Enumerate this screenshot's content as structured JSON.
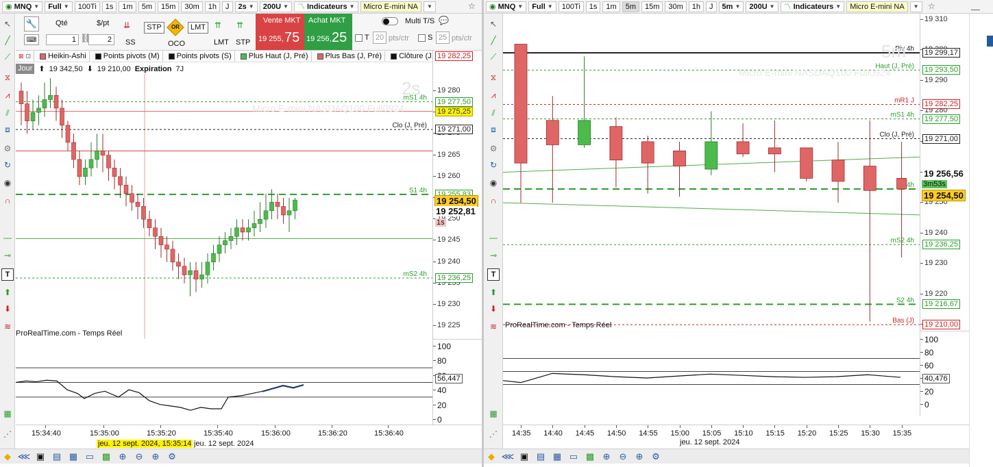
{
  "left_toolbar": {
    "symbol": "MNQ",
    "range": "Full",
    "ticks": "100Ti",
    "tf": [
      "1s",
      "1m",
      "5m",
      "15m",
      "30m",
      "1h",
      "J"
    ],
    "interval": "2s",
    "units": "200U",
    "indicators": "Indicateurs",
    "instrument": "Micro E-mini NA"
  },
  "right_toolbar": {
    "symbol": "MNQ",
    "range": "Full",
    "ticks": "100Ti",
    "tf": [
      "1s",
      "1m",
      "5m",
      "15m",
      "30m",
      "1h",
      "J"
    ],
    "interval": "5m",
    "units": "200U",
    "indicators": "Indicateurs",
    "instrument": "Micro E-mini NA"
  },
  "order_panel": {
    "qty_label": "Qté",
    "qty": "1",
    "pt_label": "$/pt",
    "pt": "2",
    "ss": "SS",
    "stp": "STP",
    "oco": "OCO",
    "or": "OR",
    "lmt": "LMT",
    "lmt2": "LMT",
    "stp2": "STP",
    "sell_label": "Vente MKT",
    "sell_main": "19 255,",
    "sell_big": "75",
    "buy_label": "Achat MKT",
    "buy_main": "19 256,",
    "buy_big": "25",
    "multi": "Multi T/S",
    "t_label": "T",
    "t_val": "20",
    "pts_ctr": "pts/ctr",
    "s_label": "S",
    "s_val": "25"
  },
  "legend": [
    "Heikin-Ashi",
    "Points pivots (M)",
    "Points pivots (S)",
    "Plus Haut (J, Pré)",
    "Plus Bas (J, Pré)",
    "Clôture (J, P"
  ],
  "info_bar": {
    "jour": "Jour",
    "high": "19 342,50",
    "low": "19 210,00",
    "exp": "Expiration",
    "exp_val": "7J"
  },
  "left_chart": {
    "watermark": "2s",
    "watermark_sub": "Micro E-mini NASDAQ100 Full0924",
    "y_ticks": [
      "19 280",
      "19 275",
      "19 270",
      "19 265",
      "19 260",
      "19 255",
      "19 250",
      "19 245",
      "19 240",
      "19 235",
      "19 230",
      "19 225"
    ],
    "levels": [
      {
        "label": "mS1 4h",
        "price": "19 277,50",
        "color": "#2a9d2a"
      },
      {
        "label": "",
        "price": "19 275,25",
        "color": "#cc2222"
      },
      {
        "label": "Clo (J, Pré)",
        "price": "19 271,00",
        "color": "#222222"
      },
      {
        "label": "S1 4h",
        "price": "19 255,83",
        "color": "#2a9d2a"
      },
      {
        "label": "mS2 4h",
        "price": "19 236,25",
        "color": "#2a9d2a"
      }
    ],
    "top_tag": "19 282,25",
    "last_price": "19 254,50",
    "ref_price": "19 252,81",
    "timer": "1s",
    "x_ticks": [
      "15:34:40",
      "15:35:00",
      "15:35:20",
      "15:35:40",
      "15:36:00",
      "15:36:20",
      "15:36:40"
    ],
    "date_highlight": "jeu. 12 sept. 2024, 15:35:14",
    "date": "jeu. 12 sept. 2024",
    "source": "ProRealTime.com - Temps Réel",
    "osc_ticks": [
      "100",
      "80",
      "60",
      "40",
      "20",
      "0"
    ],
    "osc_value": "56,447"
  },
  "right_chart": {
    "watermark": "5m",
    "watermark_sub": "Micro E-mini NASDAQ100 Full0924",
    "y_ticks": [
      "19 310",
      "19 300",
      "19 290",
      "19 280",
      "19 270",
      "19 260",
      "19 250",
      "19 240",
      "19 230",
      "19 220",
      "19 210"
    ],
    "levels": [
      {
        "label": "Piv 4h",
        "price": "19 299,17",
        "color": "#222222"
      },
      {
        "label": "Haut (J, Pré)",
        "price": "19 293,50",
        "color": "#2a9d2a"
      },
      {
        "label": "mR1 J",
        "price": "19 282,25",
        "color": "#cc2222"
      },
      {
        "label": "mS1 4h",
        "price": "19 277,50",
        "color": "#2a9d2a"
      },
      {
        "label": "Clo (J, Pré)",
        "price": "19 271,00",
        "color": "#222222"
      },
      {
        "label": "S1 4h",
        "price": "19 254,50",
        "color": "#2a9d2a"
      },
      {
        "label": "mS2 4h",
        "price": "19 236,25",
        "color": "#2a9d2a"
      },
      {
        "label": "S2 4h",
        "price": "19 216,67",
        "color": "#2a9d2a"
      },
      {
        "label": "Bas (J)",
        "price": "19 210,00",
        "color": "#cc2222"
      }
    ],
    "ref_price": "19 256,56",
    "timer": "3m53s",
    "last_price": "19 254,50",
    "x_ticks": [
      "14:35",
      "14:40",
      "14:45",
      "14:50",
      "14:55",
      "15:00",
      "15:05",
      "15:10",
      "15:15",
      "15:20",
      "15:25",
      "15:30",
      "15:35"
    ],
    "date": "jeu. 12 sept. 2024",
    "source": "ProRealTime.com - Temps Réel",
    "osc_ticks": [
      "100",
      "80",
      "60",
      "40",
      "20",
      "0"
    ],
    "osc_value": "40,476"
  },
  "chart_data": [
    {
      "type": "candlestick",
      "title": "2s",
      "ylim": [
        19222,
        19284
      ],
      "candles": [
        [
          19280,
          19277,
          19282,
          19272
        ],
        [
          19277,
          19273,
          19280,
          19270
        ],
        [
          19273,
          19275,
          19278,
          19271
        ],
        [
          19275,
          19276,
          19279,
          19272
        ],
        [
          19276,
          19278,
          19282,
          19274
        ],
        [
          19278,
          19279,
          19283,
          19276
        ],
        [
          19279,
          19276,
          19281,
          19273
        ],
        [
          19276,
          19272,
          19278,
          19269
        ],
        [
          19272,
          19268,
          19273,
          19266
        ],
        [
          19268,
          19264,
          19270,
          19262
        ],
        [
          19264,
          19260,
          19266,
          19258
        ],
        [
          19260,
          19262,
          19264,
          19258
        ],
        [
          19262,
          19264,
          19268,
          19260
        ],
        [
          19264,
          19266,
          19270,
          19262
        ],
        [
          19266,
          19265,
          19270,
          19261
        ],
        [
          19265,
          19262,
          19266,
          19259
        ],
        [
          19262,
          19260,
          19264,
          19257
        ],
        [
          19260,
          19258,
          19262,
          19255
        ],
        [
          19258,
          19256,
          19260,
          19253
        ],
        [
          19256,
          19254,
          19258,
          19252
        ],
        [
          19254,
          19253,
          19256,
          19250
        ],
        [
          19253,
          19250,
          19255,
          19248
        ],
        [
          19250,
          19248,
          19252,
          19246
        ],
        [
          19248,
          19246,
          19250,
          19243
        ],
        [
          19246,
          19244,
          19248,
          19241
        ],
        [
          19244,
          19243,
          19246,
          19240
        ],
        [
          19243,
          19240,
          19245,
          19238
        ],
        [
          19240,
          19239,
          19242,
          19236
        ],
        [
          19239,
          19237,
          19241,
          19235
        ],
        [
          19237,
          19238,
          19240,
          19232
        ],
        [
          19238,
          19236,
          19240,
          19233
        ],
        [
          19236,
          19237,
          19240,
          19234
        ],
        [
          19237,
          19240,
          19242,
          19235
        ],
        [
          19240,
          19242,
          19244,
          19238
        ],
        [
          19242,
          19244,
          19246,
          19240
        ],
        [
          19244,
          19245,
          19247,
          19242
        ],
        [
          19245,
          19246,
          19248,
          19243
        ],
        [
          19246,
          19248,
          19250,
          19244
        ],
        [
          19248,
          19247,
          19250,
          19245
        ],
        [
          19247,
          19248,
          19250,
          19245
        ],
        [
          19248,
          19249,
          19252,
          19246
        ],
        [
          19249,
          19250,
          19254,
          19247
        ],
        [
          19250,
          19252,
          19256,
          19248
        ],
        [
          19252,
          19254,
          19257,
          19250
        ],
        [
          19254,
          19253,
          19256,
          19250
        ],
        [
          19253,
          19251,
          19255,
          19249
        ],
        [
          19251,
          19252,
          19255,
          19247
        ],
        [
          19252,
          19254.5,
          19255,
          19250
        ]
      ]
    },
    {
      "type": "candlestick",
      "title": "5m",
      "x": [
        "14:35",
        "14:40",
        "14:45",
        "14:50",
        "14:55",
        "15:00",
        "15:05",
        "15:10",
        "15:15",
        "15:20",
        "15:25",
        "15:30",
        "15:35"
      ],
      "ylim": [
        19208,
        19312
      ],
      "candles": [
        [
          19302,
          19263,
          19302,
          19250
        ],
        [
          19277,
          19269,
          19285,
          19250
        ],
        [
          19269,
          19277,
          19298,
          19268
        ],
        [
          19275,
          19264,
          19278,
          19255
        ],
        [
          19270,
          19263,
          19272,
          19253
        ],
        [
          19267,
          19262,
          19270,
          19252
        ],
        [
          19261,
          19270,
          19280,
          19259
        ],
        [
          19270,
          19266,
          19276,
          19265
        ],
        [
          19268,
          19266,
          19277,
          19260
        ],
        [
          19268,
          19258,
          19268,
          19257
        ],
        [
          19264,
          19257,
          19270,
          19250
        ],
        [
          19262,
          19254,
          19277,
          19211
        ],
        [
          19258,
          19254.5,
          19270,
          19232
        ]
      ]
    }
  ]
}
